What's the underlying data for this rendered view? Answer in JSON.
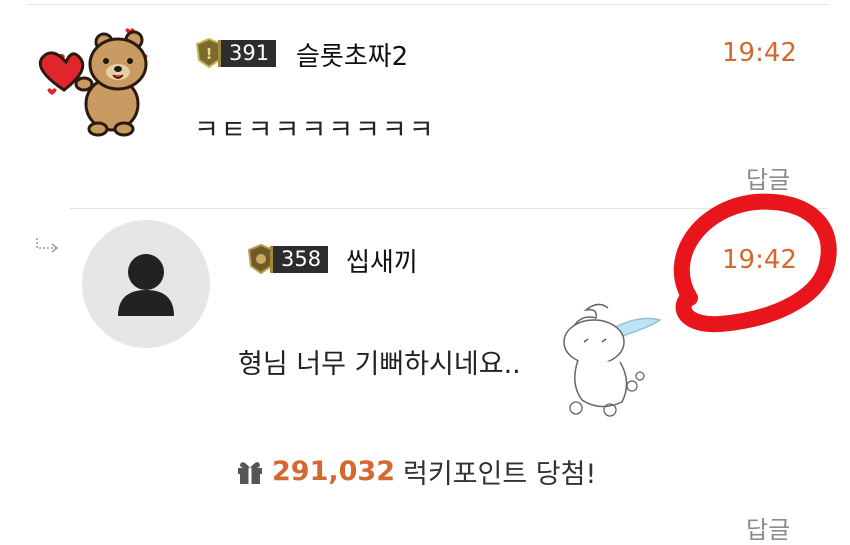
{
  "comment1": {
    "level": "391",
    "nickname": "슬롯초짜2",
    "time": "19:42",
    "message": "ㅋㅌㅋㅋㅋㅋㅋㅋㅋ",
    "reply_label": "답글"
  },
  "comment2": {
    "level": "358",
    "nickname": "씹새끼",
    "time": "19:42",
    "message": "형님 너무 기뻐하시네요..",
    "prize_amount": "291,032",
    "prize_text": "럭키포인트 당첨!",
    "reply_label": "답글"
  },
  "colors": {
    "accent": "#d3692f",
    "badge_bg": "#2d2d2d",
    "annotation_red": "#e8151c",
    "avatar_bg": "#e6e6e6"
  },
  "icons": [
    "bear-sticker-avatar",
    "level-badge-icon",
    "reply-arrow-icon",
    "default-user-icon",
    "gift-icon",
    "character-doodle"
  ]
}
